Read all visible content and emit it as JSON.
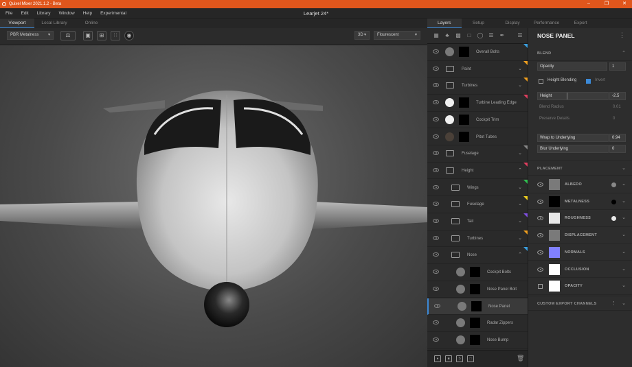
{
  "window": {
    "title": "Quixel Mixer 2021.1.2 - Beta",
    "document": "Learjet 24*"
  },
  "menu": [
    "File",
    "Edit",
    "Library",
    "Window",
    "Help",
    "Experimental"
  ],
  "viewport_tabs": [
    {
      "label": "Viewport",
      "active": true
    },
    {
      "label": "Local Library",
      "active": false
    },
    {
      "label": "Online",
      "active": false
    }
  ],
  "viewport_toolbar": {
    "material_mode": "PBR Metalness",
    "view_mode": "3D",
    "lighting": "Flourescent"
  },
  "right_tabs": [
    {
      "label": "Layers",
      "active": true
    },
    {
      "label": "Setup",
      "active": false
    },
    {
      "label": "Display",
      "active": false
    },
    {
      "label": "Performance",
      "active": false
    },
    {
      "label": "Export",
      "active": false
    }
  ],
  "layers": [
    {
      "name": "Overall Bolts",
      "kind": "layer",
      "indent": 0,
      "ball": "#7a7a7a",
      "tag": "#3aa0e0"
    },
    {
      "name": "Paint",
      "kind": "folder",
      "indent": 0,
      "tag": "#f0a020"
    },
    {
      "name": "Turbines",
      "kind": "folder",
      "indent": 0,
      "tag": "#f0a020"
    },
    {
      "name": "Turbine Leading Edge",
      "kind": "layer",
      "indent": 0,
      "ball": "#f0f0f0",
      "tag": "#e04060"
    },
    {
      "name": "Cockpit Trim",
      "kind": "layer",
      "indent": 0,
      "ball": "#f0f0f0",
      "tag": ""
    },
    {
      "name": "Pitot Tubes",
      "kind": "layer",
      "indent": 0,
      "ball": "#4a4038",
      "tag": ""
    },
    {
      "name": "Fuselage",
      "kind": "folder",
      "indent": 0,
      "tag": "#888888"
    },
    {
      "name": "Height",
      "kind": "folder",
      "indent": 0,
      "tag": "#e04060",
      "open": true
    },
    {
      "name": "Wings",
      "kind": "folder",
      "indent": 1,
      "tag": "#30c050"
    },
    {
      "name": "Fuselage",
      "kind": "folder",
      "indent": 1,
      "tag": "#f0d020"
    },
    {
      "name": "Tail",
      "kind": "folder",
      "indent": 1,
      "tag": "#8050e0"
    },
    {
      "name": "Turbines",
      "kind": "folder",
      "indent": 1,
      "tag": "#f0a020"
    },
    {
      "name": "Nose",
      "kind": "folder",
      "indent": 1,
      "tag": "#3aa0e0",
      "open": true
    },
    {
      "name": "Cockpit Bolts",
      "kind": "layer",
      "indent": 2,
      "ball": "#7a7a7a",
      "tag": ""
    },
    {
      "name": "Nose Panel Bolt",
      "kind": "layer",
      "indent": 2,
      "ball": "#7a7a7a",
      "tag": ""
    },
    {
      "name": "Nose Panel",
      "kind": "layer",
      "indent": 2,
      "ball": "#7a7a7a",
      "tag": "",
      "selected": true
    },
    {
      "name": "Radar Zippers",
      "kind": "layer",
      "indent": 2,
      "ball": "#7a7a7a",
      "tag": ""
    },
    {
      "name": "Nose Bump",
      "kind": "layer",
      "indent": 2,
      "ball": "#7a7a7a",
      "tag": ""
    }
  ],
  "properties": {
    "title": "NOSE PANEL",
    "blend": {
      "section": "BLEND",
      "mode": "Opacity",
      "mode_value": "1",
      "height_blending": "Height Blending",
      "invert": "Invert",
      "height_label": "Height",
      "height_value": "-2.5",
      "blend_radius_label": "Blend Radius",
      "blend_radius_value": "0.01",
      "preserve_details": "Preserve Details",
      "preserve_value": "0",
      "wrap_label": "Wrap to Underlying",
      "wrap_value": "0.94",
      "blur_label": "Blur Underlying",
      "blur_value": "0"
    },
    "placement": "PLACEMENT",
    "channels": [
      {
        "name": "ALBEDO",
        "color": "#7a7a7a",
        "dot": "#888888"
      },
      {
        "name": "METALNESS",
        "color": "#000000",
        "dot": "#000000"
      },
      {
        "name": "ROUGHNESS",
        "color": "#e8e8e8",
        "dot": "#e8e8e8"
      },
      {
        "name": "DISPLACEMENT",
        "color": "#7a7a7a",
        "dot": ""
      },
      {
        "name": "NORMALS",
        "color": "#8080ff",
        "dot": ""
      },
      {
        "name": "OCCLUSION",
        "color": "#ffffff",
        "dot": ""
      },
      {
        "name": "OPACITY",
        "color": "#ffffff",
        "dot": ""
      }
    ],
    "custom_export": "CUSTOM EXPORT CHANNELS"
  }
}
